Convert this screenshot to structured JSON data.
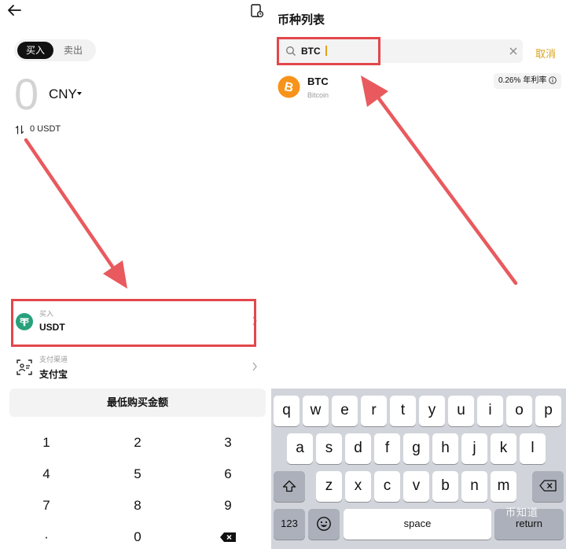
{
  "left": {
    "tabs": {
      "buy": "买入",
      "sell": "卖出"
    },
    "amount": "0",
    "currency": "CNY",
    "convert_text": "0 USDT",
    "buy_row": {
      "label": "买入",
      "value": "USDT"
    },
    "pay_row": {
      "label": "支付渠道",
      "value": "支付宝"
    },
    "min_button": "最低购买金额",
    "numpad": [
      "1",
      "2",
      "3",
      "4",
      "5",
      "6",
      "7",
      "8",
      "9",
      "·",
      "0"
    ]
  },
  "right": {
    "title": "币种列表",
    "search": {
      "value": "BTC",
      "cancel": "取消"
    },
    "coin": {
      "symbol": "BTC",
      "name": "Bitcoin",
      "rate": "0.26%",
      "rate_label": "年利率"
    },
    "keyboard": {
      "row1": [
        "q",
        "w",
        "e",
        "r",
        "t",
        "y",
        "u",
        "i",
        "o",
        "p"
      ],
      "row2": [
        "a",
        "s",
        "d",
        "f",
        "g",
        "h",
        "j",
        "k",
        "l"
      ],
      "row3": [
        "z",
        "x",
        "c",
        "v",
        "b",
        "n",
        "m"
      ],
      "numbers": "123",
      "space": "space",
      "return": "return"
    },
    "watermark": "币知道"
  },
  "colors": {
    "highlight": "#e2474b",
    "accent": "#d9a21c",
    "tether": "#26a17b",
    "bitcoin": "#f7931a"
  },
  "icons": [
    "back-arrow-icon",
    "history-icon",
    "swap-icon",
    "tether-icon",
    "payment-channel-icon",
    "chevron-right-icon",
    "backspace-icon",
    "search-icon",
    "clear-icon",
    "bitcoin-icon",
    "info-icon",
    "shift-icon",
    "emoji-icon",
    "keyboard-backspace-icon"
  ]
}
